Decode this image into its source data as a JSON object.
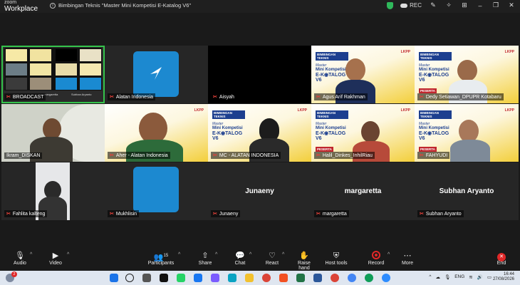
{
  "app": {
    "brand_line1": "zoom",
    "brand_line2": "Workplace",
    "meeting_title": "Bimbingan Teknis \"Master Mini Kompetisi E-Katalog V6\"",
    "rec_label": "REC"
  },
  "slide": {
    "line1": "BIMBINGAN TEKNIS",
    "line2": "Master",
    "line3": "Mini Kompetisi",
    "line4": "E-K◉TALOG V6",
    "badge": "PESERTA",
    "badge2": "PEMATERI",
    "logo": "LKPP"
  },
  "thumbnail": {
    "labels": [
      "margaretta",
      "Subhan Aryanto"
    ]
  },
  "participants": [
    {
      "name": "BROADCAST"
    },
    {
      "name": "Alatan Indonesia"
    },
    {
      "name": "Aisyah"
    },
    {
      "name": "Agus Arif Rakhman"
    },
    {
      "name": "Dedy Setiawan_DPUPR Kotabaru"
    },
    {
      "name": "Ikram_DISKAN"
    },
    {
      "name": "Aher - Alatan Indonesia"
    },
    {
      "name": "MC - ALATAN INDONESIA"
    },
    {
      "name": "Halil_Dinkes_InhilRiau"
    },
    {
      "name": "FAHYUDI"
    },
    {
      "name": "Fahlita kalteng"
    },
    {
      "name": "Mukhlisin"
    },
    {
      "name": "Junaeny"
    },
    {
      "name": "margaretta"
    },
    {
      "name": "Subhan Aryanto"
    }
  ],
  "toolbar": {
    "audio": "Audio",
    "video": "Video",
    "participants": "Participants",
    "participants_count": "15",
    "share": "Share",
    "chat": "Chat",
    "react": "React",
    "raise_hand": "Raise hand",
    "host_tools": "Host tools",
    "record": "Record",
    "more": "More",
    "end": "End"
  },
  "taskbar": {
    "lang": "ENG",
    "time": "16:44",
    "date": "27/08/2026",
    "badge": "2"
  },
  "colors": {
    "accent_green": "#35c34b",
    "mute_red": "#e6413a",
    "slide_blue": "#1d3f8f",
    "slide_yellow": "#f3cf3b"
  }
}
